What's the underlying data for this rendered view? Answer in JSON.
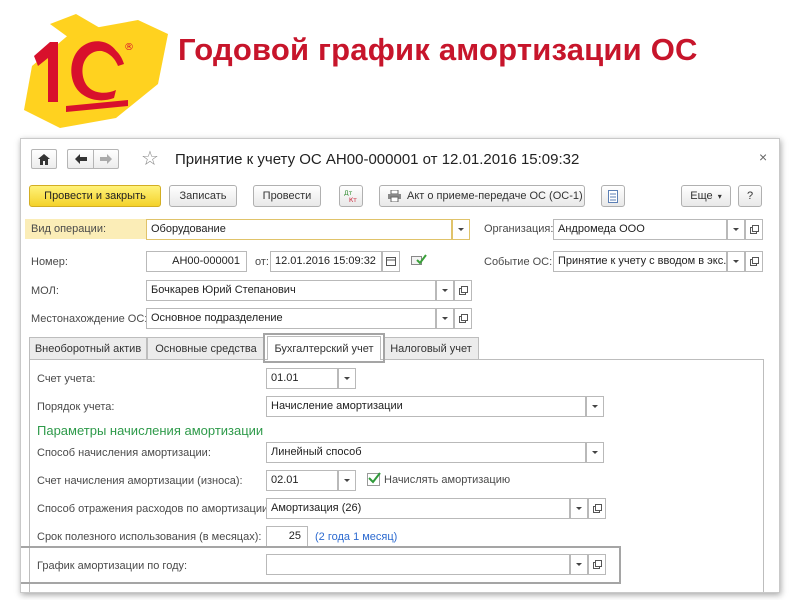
{
  "slide": {
    "title": "Годовой график амортизации ОС"
  },
  "colors": {
    "title": "#c7152b",
    "logo_yellow": "#ffd21f",
    "logo_red": "#d8102c",
    "primary_button": "#f4d22b",
    "section_title": "#2e9a4a",
    "link": "#2c6ad0"
  },
  "window": {
    "doc_title": "Принятие к учету ОС АН00-000001 от 12.01.2016 15:09:32",
    "close_icon": "×"
  },
  "toolbar": {
    "post_and_close": "Провести и закрыть",
    "save": "Записать",
    "post": "Провести",
    "act_button": "Акт о приеме-передаче ОС (ОС-1)",
    "more": "Еще",
    "help": "?"
  },
  "form": {
    "operation_label": "Вид операции:",
    "operation_value": "Оборудование",
    "org_label": "Организация:",
    "org_value": "Андромеда ООО",
    "number_label": "Номер:",
    "number_value": "АН00-000001",
    "date_label": "от:",
    "date_value": "12.01.2016 15:09:32",
    "event_label": "Событие ОС:",
    "event_value": "Принятие к учету с вводом в экс.",
    "mol_label": "МОЛ:",
    "mol_value": "Бочкарев Юрий Степанович",
    "location_label": "Местонахождение ОС:",
    "location_value": "Основное подразделение"
  },
  "tabs": [
    {
      "label": "Внеоборотный актив"
    },
    {
      "label": "Основные средства"
    },
    {
      "label": "Бухгалтерский учет"
    },
    {
      "label": "Налоговый учет"
    }
  ],
  "accounting": {
    "account_label": "Счет учета:",
    "account_value": "01.01",
    "order_label": "Порядок учета:",
    "order_value": "Начисление амортизации",
    "params_title": "Параметры начисления амортизации",
    "method_label": "Способ начисления амортизации:",
    "method_value": "Линейный способ",
    "depr_account_label": "Счет начисления амортизации (износа):",
    "depr_account_value": "02.01",
    "accrue_label": "Начислять амортизацию",
    "accrue_checked": true,
    "expense_label": "Способ отражения расходов по амортизации:",
    "expense_value": "Амортизация (26)",
    "useful_life_label": "Срок полезного использования (в месяцах):",
    "useful_life_value": "25",
    "useful_life_hint": "(2 года 1 месяц)",
    "schedule_label": "График амортизации по году:",
    "schedule_value": ""
  }
}
